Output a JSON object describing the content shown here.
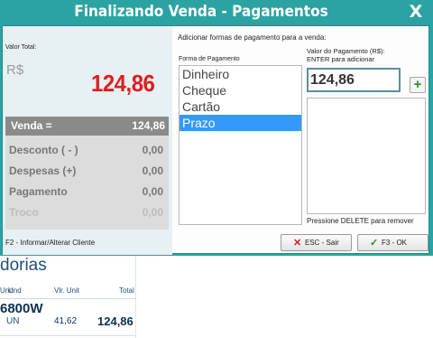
{
  "background_app": {
    "section_title": "dorias",
    "columns": {
      "und_1": "Und",
      "und_2": "Und",
      "unit_price": "Vlr. Unit",
      "total": "Total"
    },
    "row": {
      "product": "6800W",
      "unit": "UN",
      "unit_price": "41,62",
      "total": "124,86"
    }
  },
  "dialog": {
    "title": "Finalizando Venda - Pagamentos",
    "close_label": "X"
  },
  "summary": {
    "total_label": "Valor Total:",
    "currency": "R$",
    "total_value": "124,86",
    "rows": [
      {
        "label": "Venda =",
        "value": "124,86"
      },
      {
        "label": "Desconto ( - )",
        "value": "0,00"
      },
      {
        "label": "Despesas (+)",
        "value": "0,00"
      },
      {
        "label": "Pagamento",
        "value": "0,00"
      },
      {
        "label": "Troco",
        "value": "0,00"
      }
    ],
    "footer_hint": "F2 - Informar/Alterar Cliente"
  },
  "payments": {
    "section_title": "Adicionar formas de pagamento para a venda:",
    "forms_label": "Forma de Pagamento",
    "forms": [
      "Dinheiro",
      "Cheque",
      "Cartão",
      "Prazo"
    ],
    "selected_form": "Prazo",
    "value_label_line1": "Valor do Pagamento (R$):",
    "value_label_line2": "ENTER para adicionar",
    "value_input": "124,86",
    "add_label": "+",
    "delete_hint": "Pressione DELETE para remover",
    "esc_label": "ESC - Sair",
    "ok_label": "F3 - OK"
  },
  "colors": {
    "title_bar": "#2ba3a3",
    "total_value": "#e01e1e",
    "selected_item": "#3399ff",
    "add_icon": "#2a8a2a",
    "esc_icon": "#d41f1f"
  },
  "icons": {
    "add": "plus-icon",
    "esc": "x-icon",
    "ok": "check-icon",
    "close": "close-icon"
  }
}
